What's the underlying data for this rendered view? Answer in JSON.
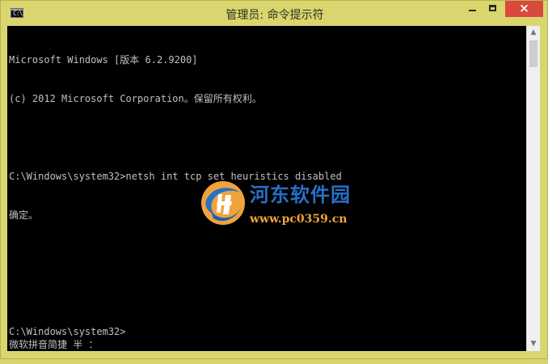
{
  "window": {
    "title": "管理员: 命令提示符",
    "icon_text": "C:\\",
    "close_icon": "×",
    "console_lines": [
      "Microsoft Windows [版本 6.2.9200]",
      "(c) 2012 Microsoft Corporation。保留所有权利。",
      "",
      "C:\\Windows\\system32>netsh int tcp set heuristics disabled",
      "确定。",
      "",
      "",
      "C:\\Windows\\system32>"
    ],
    "ime_status": "微软拼音简捷 半 ："
  },
  "watermark": {
    "name": "河东软件园",
    "url": "www.pc0359.cn"
  },
  "colors": {
    "frame": "#d9d66f",
    "console_bg": "#000000",
    "console_text": "#c0c0c0",
    "close_button": "#d9493c",
    "watermark_blue": "#2770c8",
    "watermark_orange": "#f0a33b"
  },
  "icons": {
    "app": "cmd-icon",
    "minimize": "minimize-icon",
    "maximize": "maximize-icon",
    "close": "close-icon",
    "scroll_up": "scroll-up-icon",
    "scroll_down": "scroll-down-icon"
  }
}
